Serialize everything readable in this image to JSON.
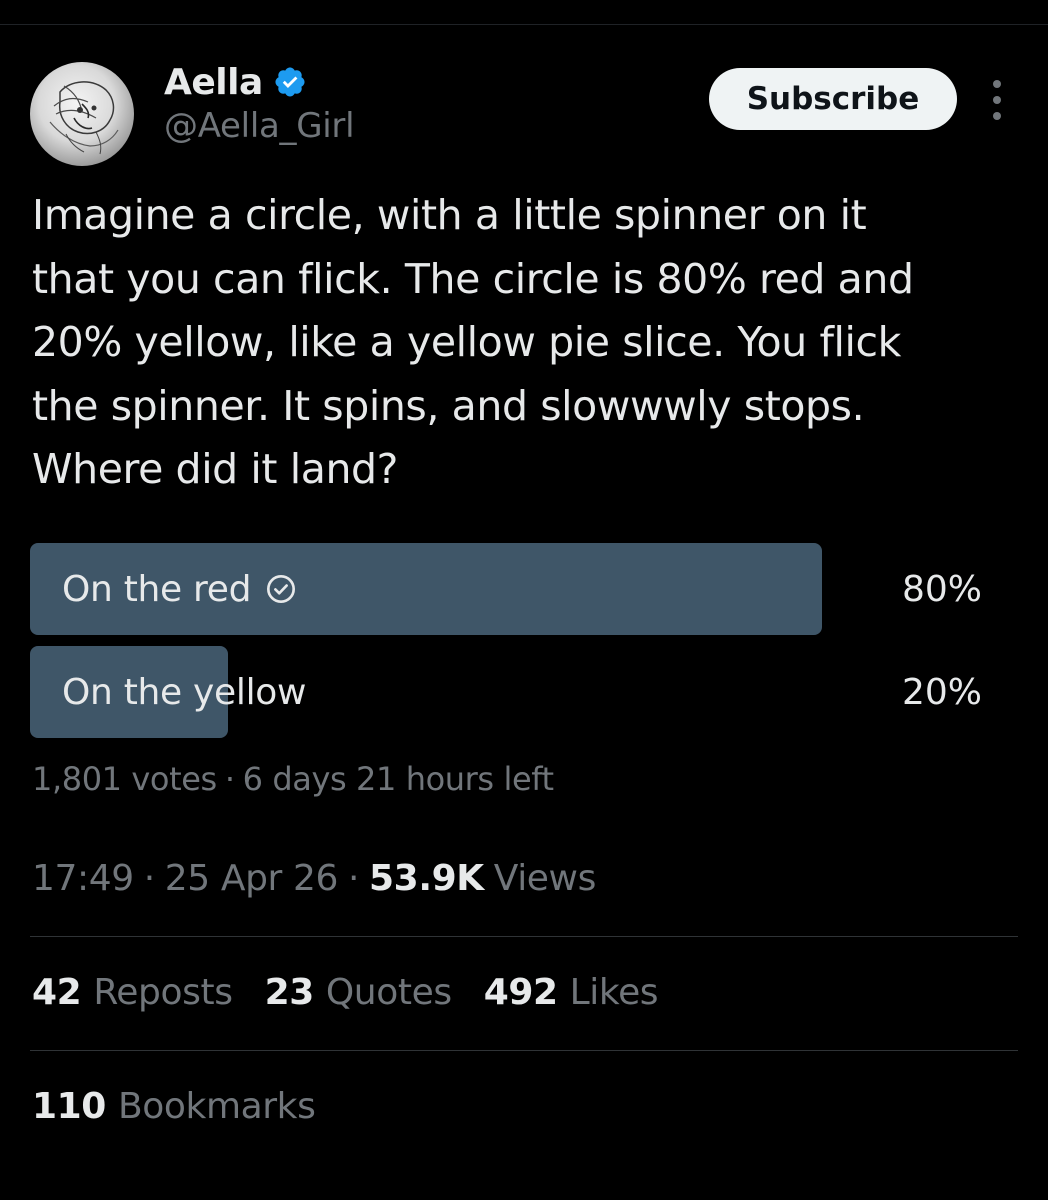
{
  "author": {
    "display_name": "Aella",
    "handle": "@Aella_Girl",
    "verified": true,
    "avatar_icon": "sketch-portrait-avatar"
  },
  "header": {
    "subscribe_label": "Subscribe",
    "more_icon": "more-vertical-icon"
  },
  "tweet": {
    "text": "Imagine a circle, with a little spinner on it\nthat you can flick. The circle is 80% red and\n20% yellow, like a yellow pie slice. You flick\nthe spinner. It spins, and slowwwly stops.\nWhere did it land?"
  },
  "poll": {
    "options": [
      {
        "label": "On the red",
        "percent_text": "80%",
        "percent": 80,
        "selected": true
      },
      {
        "label": "On the yellow",
        "percent_text": "20%",
        "percent": 20,
        "selected": false
      }
    ],
    "votes": "1,801 votes",
    "separator": "·",
    "time_left": "6 days 21 hours left"
  },
  "meta": {
    "time": "17:49",
    "date": "25 Apr 26",
    "separator": "·",
    "views_count": "53.9K",
    "views_label": "Views"
  },
  "stats": {
    "reposts_count": "42",
    "reposts_label": "Reposts",
    "quotes_count": "23",
    "quotes_label": "Quotes",
    "likes_count": "492",
    "likes_label": "Likes",
    "bookmarks_count": "110",
    "bookmarks_label": "Bookmarks"
  },
  "colors": {
    "background": "#000000",
    "text_primary": "#e7e9ea",
    "text_secondary": "#71767b",
    "poll_fill": "#3f5668",
    "verified_blue": "#1d9bf0",
    "divider": "#2f3336",
    "subscribe_bg": "#eff3f4"
  }
}
